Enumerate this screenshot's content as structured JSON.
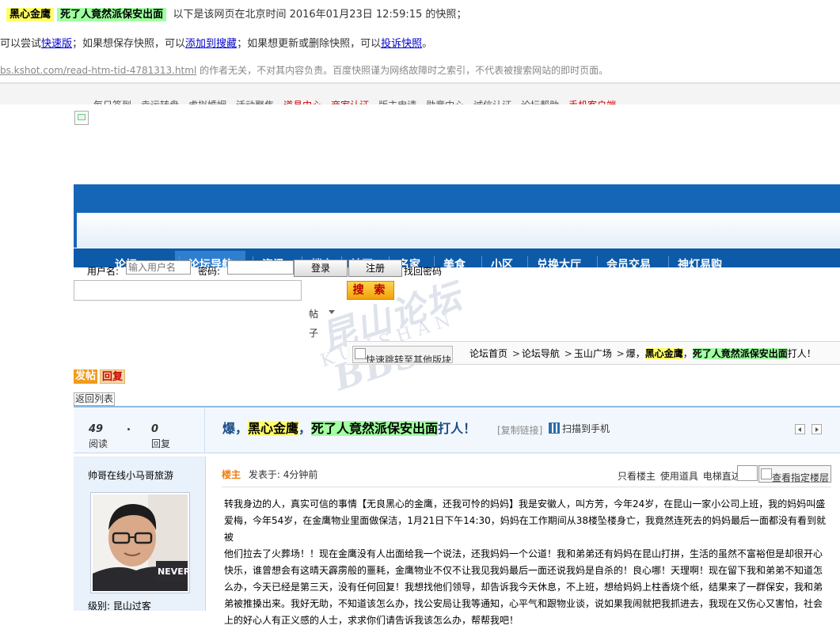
{
  "snapshot": {
    "kw1": "黑心金鹰",
    "kw2": "死了人竟然派保安出面",
    "desc": "以下是该网页在北京时间 2016年01月23日 12:59:15 的快照；",
    "line2_pre": "可以尝试",
    "fast_link": "快速版",
    "line2_mid": "；如果想保存快照，可以",
    "add_link": "添加到搜藏",
    "line2_mid2": "；如果想更新或删除快照，可以",
    "complain_link": "投诉快照",
    "line2_end": "。",
    "url": "bs.kshot.com/read-htm-tid-4781313.html",
    "disclaimer": " 的作者无关，不对其内容负责。百度快照谨为网络故障时之索引，不代表被搜索网站的即时页面。"
  },
  "topnav": {
    "items": [
      {
        "label": "每日签到",
        "red": false
      },
      {
        "label": "幸运转盘",
        "red": false
      },
      {
        "label": "虚拟婚姻",
        "red": false
      },
      {
        "label": "活动聚焦",
        "red": false
      },
      {
        "label": "道具中心",
        "red": true
      },
      {
        "label": "商家认证",
        "red": true
      },
      {
        "label": "版主申请",
        "red": false
      },
      {
        "label": "勋章中心",
        "red": false
      },
      {
        "label": "诚信认证",
        "red": false
      },
      {
        "label": "论坛帮助",
        "red": false
      },
      {
        "label": "手机客户端",
        "red": true
      }
    ]
  },
  "mainnav": {
    "items": [
      "论坛",
      "论坛导航",
      "资讯",
      "楼市",
      "社区",
      "名家",
      "美食",
      "小区",
      "兑换大厅",
      "会员交易",
      "神灯易购"
    ]
  },
  "login": {
    "username_label": "用户名:",
    "username_placeholder": "输入用户名",
    "password_label": "密码:",
    "login_button": "登录",
    "register_button": "注册",
    "forgot": "找回密码"
  },
  "search": {
    "button": "搜 索",
    "type_label": "帖",
    "type_label2": "子"
  },
  "watermark": {
    "line1": "昆山论坛 BBS",
    "line2": "KUNSHAN"
  },
  "breadcrumb": {
    "jump": "快速跳转至其他版块",
    "home": "论坛首页",
    "nav": "论坛导航",
    "forum": "玉山广场",
    "prefix": "爆，",
    "hl1": "黑心金鹰",
    "comma": "，",
    "hl2": "死了人竟然派保安出面",
    "suffix": "打人！"
  },
  "actions": {
    "post": "发帖",
    "reply": "回复",
    "back": "返回列表"
  },
  "thread": {
    "views": "49",
    "views_label": "阅读",
    "replies": "0",
    "replies_label": "回复",
    "title_prefix": "爆，",
    "title_hl1": "黑心金鹰",
    "title_comma": "，",
    "title_hl2": "死了人竟然派保安出面",
    "title_suffix": "打人！",
    "copy_link": "[复制链接]",
    "scan": "扫描到手机"
  },
  "user": {
    "name": "帅哥在线小马哥旅游",
    "level_label": "级别:",
    "level": "昆山过客",
    "avatar_text": "NEVER"
  },
  "post": {
    "floor": "楼主",
    "published": "发表于: 4分钟前",
    "only_host": "只看楼主",
    "use_tool": "使用道具",
    "elevator": "电梯直达",
    "view_floor": "查看指定楼层",
    "lines": [
      "转我身边的人，真实可信的事情【无良黑心的金鹰，还我可怜的妈妈】我是安徽人，叫方芳，今年24岁，在昆山一家小公司上班，我的妈妈叫盛",
      "爱梅，今年54岁，在金鹰物业里面做保洁，1月21日下午14:30，妈妈在工作期间从38楼坠楼身亡，我竟然连死去的妈妈最后一面都没有看到就被",
      "他们拉去了火葬场！！现在金鹰没有人出面给我一个说法，还我妈妈一个公道！我和弟弟还有妈妈在昆山打拼，生活的虽然不富裕但是却很开心",
      "快乐，谁曾想会有这晴天霹雳般的噩耗，金鹰物业不仅不让我见我妈最后一面还说我妈是自杀的！良心哪！天理啊！现在留下我和弟弟不知道怎",
      "么办，今天已经是第三天，没有任何回复！我想找他们领导，却告诉我今天休息，不上班，想给妈妈上柱香烧个纸，结果来了一群保安，我和弟",
      "弟被推搡出来。我好无助，不知道该怎么办，找公安局让我等通知，心平气和跟物业谈，说如果我闹就把我抓进去，我现在又伤心又害怕，社会",
      "上的好心人有正义感的人士，求求你们请告诉我该怎么办，帮帮我吧！"
    ]
  },
  "colors": {
    "highlight_yellow": "#ffff66",
    "highlight_green": "#a0ffa0",
    "nav_blue": "#0d5aa8",
    "accent_orange": "#f17c0b"
  }
}
